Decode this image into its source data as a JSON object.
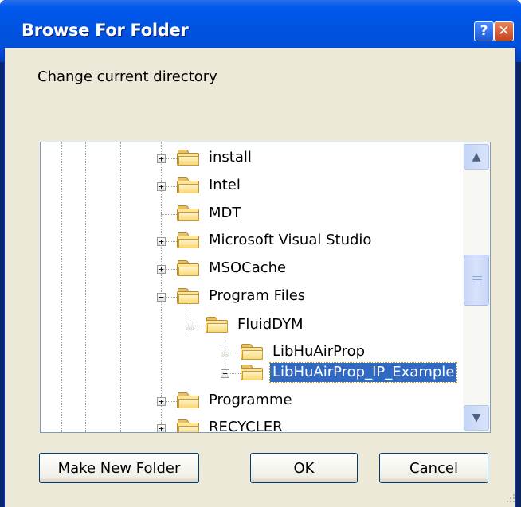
{
  "window": {
    "title": "Browse For Folder"
  },
  "titlebar_buttons": {
    "help": "?",
    "close": "✕"
  },
  "prompt": "Change current directory",
  "tree": {
    "items": [
      {
        "label": "install",
        "expander": "+"
      },
      {
        "label": "Intel",
        "expander": "+"
      },
      {
        "label": "MDT",
        "expander": ""
      },
      {
        "label": "Microsoft Visual Studio",
        "expander": "+"
      },
      {
        "label": "MSOCache",
        "expander": "+"
      },
      {
        "label": "Program Files",
        "expander": "−"
      },
      {
        "label": "FluidDYM",
        "expander": "−"
      },
      {
        "label": "LibHuAirProp",
        "expander": "+"
      },
      {
        "label": "LibHuAirProp_IP_Example",
        "expander": "+",
        "selected": true
      },
      {
        "label": "Programme",
        "expander": "+"
      },
      {
        "label": "RECYCLER",
        "expander": "+"
      }
    ]
  },
  "scrollbar": {
    "up": "▲",
    "down": "▼"
  },
  "buttons": {
    "new_folder_prefix": "M",
    "new_folder_rest": "ake New Folder",
    "ok": "OK",
    "cancel": "Cancel"
  },
  "colors": {
    "selection": "#316ac5",
    "titlebar": "#0054e3",
    "face": "#ece9d8"
  }
}
